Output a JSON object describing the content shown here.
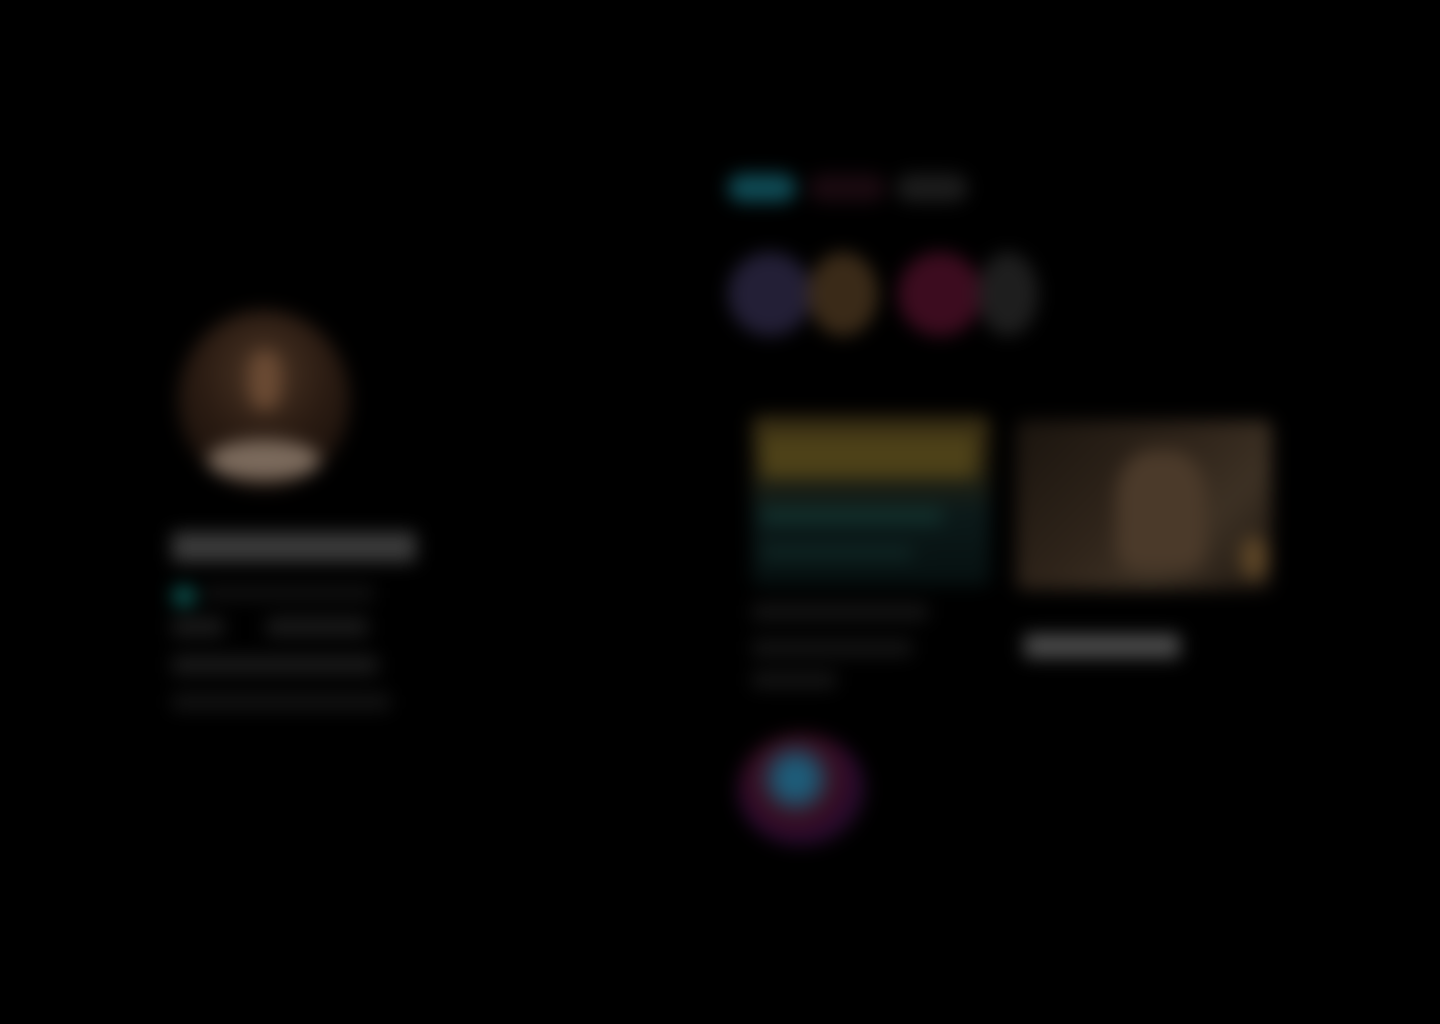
{
  "colors": {
    "background": "#000000",
    "profile_photo": "#4a3424",
    "name_bar": "#3b3b3b",
    "status_indicator": "#0d5a55",
    "tab_active": "#0f4b55",
    "tab_secondary": "#1a0a10",
    "tab_tertiary": "#1c1c1c",
    "bubble_purple": "#231f36",
    "bubble_crimson": "#3c0c1f",
    "card_gold": "#4d4118",
    "card_teal": "#12302c",
    "media_brown": "#3d3124",
    "app_icon_blue": "#1d5d7a",
    "app_icon_red": "#3a0d1c"
  },
  "profile": {
    "photo_icon": "profile-photo",
    "status_icon": "status-dot-icon"
  },
  "tabs": [
    {
      "icon": "tab-pill"
    },
    {
      "icon": "tab-pill"
    },
    {
      "icon": "tab-pill"
    }
  ],
  "stories": [
    {
      "icon": "story-avatar"
    },
    {
      "icon": "story-avatar"
    },
    {
      "icon": "story-avatar"
    },
    {
      "icon": "story-avatar"
    }
  ],
  "feed": {
    "card_icon": "feed-card-image",
    "media_icon": "media-thumbnail"
  },
  "app": {
    "icon": "app-logo-icon"
  }
}
